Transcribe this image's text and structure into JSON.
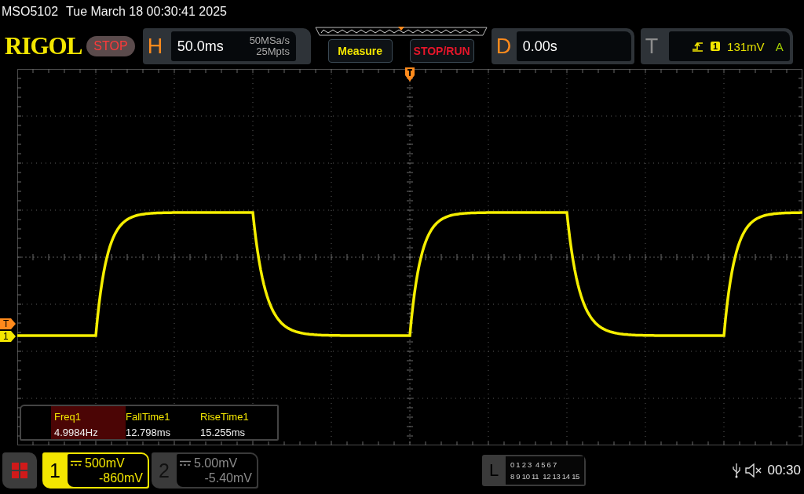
{
  "header": {
    "model": "MSO5102",
    "datetime": "Tue March 18 00:30:41 2025"
  },
  "logo": "RIGOL",
  "run_state": {
    "label": "STOP"
  },
  "horizontal": {
    "label": "H",
    "timebase": "50.0ms",
    "sample_rate": "50MSa/s",
    "memory_depth": "25Mpts"
  },
  "buttons": [
    {
      "label": "Measure",
      "kind": "measure"
    },
    {
      "label": "STOP/RUN",
      "kind": "run"
    }
  ],
  "delay": {
    "label": "D",
    "value": "0.00s"
  },
  "trigger": {
    "label": "T",
    "source": "1",
    "level": "131mV",
    "mode": "A"
  },
  "markers": [
    {
      "label": "T",
      "kind": "trigger"
    },
    {
      "label": "1",
      "kind": "channel"
    }
  ],
  "measurements": [
    {
      "label": "Freq1",
      "value": "4.9984Hz",
      "selected": true
    },
    {
      "label": "FallTime1",
      "value": "12.798ms",
      "selected": false
    },
    {
      "label": "RiseTime1",
      "value": "15.255ms",
      "selected": false
    }
  ],
  "channels": [
    {
      "number": "1",
      "scale": "500mV",
      "offset": "-860mV",
      "enabled": true
    },
    {
      "number": "2",
      "scale": "5.00mV",
      "offset": "-5.40mV",
      "enabled": false
    }
  ],
  "logic": {
    "label": "L",
    "rows": [
      [
        "0 1 2 3",
        "4 5 6 7"
      ],
      [
        "8 9 10 11",
        "12 13 14 15"
      ]
    ]
  },
  "status": {
    "time": "00:30"
  }
}
